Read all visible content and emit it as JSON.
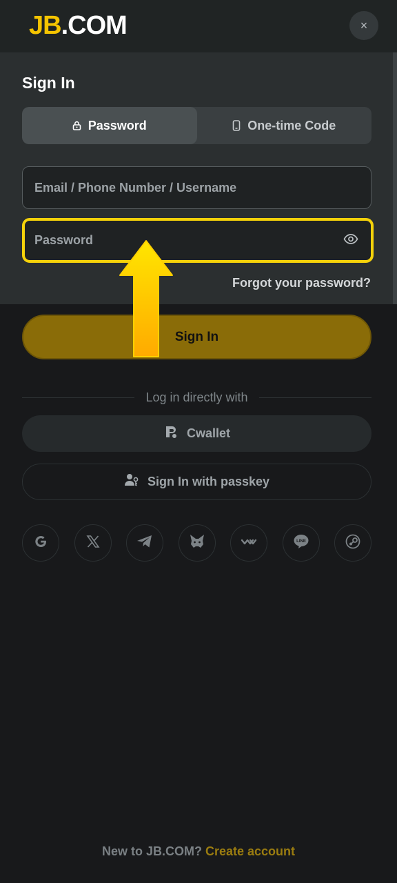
{
  "header": {
    "logo_jb": "JB",
    "logo_com": ".COM",
    "close_glyph": "×",
    "brand_color": "#f5c400"
  },
  "form": {
    "title": "Sign In",
    "tabs": [
      {
        "label": "Password",
        "icon": "lock-icon",
        "active": true
      },
      {
        "label": "One-time Code",
        "icon": "phone-icon",
        "active": false
      }
    ],
    "email_placeholder": "Email / Phone Number / Username",
    "email_value": "",
    "password_placeholder": "Password",
    "password_value": "",
    "forgot_label": "Forgot your password?",
    "submit_label": "Sign In",
    "highlight_color": "#f5d20a"
  },
  "alt_login": {
    "divider_label": "Log in directly with",
    "cwallet_label": "Cwallet",
    "passkey_label": "Sign In with passkey",
    "socials": [
      "google-icon",
      "x-icon",
      "telegram-icon",
      "metamask-icon",
      "walletconnect-icon",
      "line-icon",
      "steam-icon"
    ]
  },
  "footer": {
    "prompt": "New to JB.COM?",
    "create_label": "Create account"
  }
}
